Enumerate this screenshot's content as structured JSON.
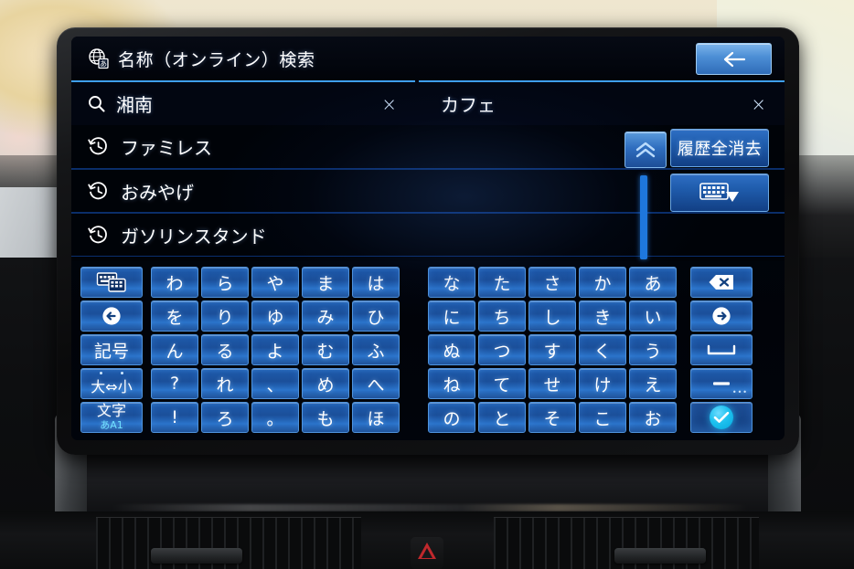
{
  "device": {
    "type": "car-navigation-head-unit",
    "hazard_button": "hazard-triangle"
  },
  "titlebar": {
    "icon": "globe-language-icon",
    "title": "名称（オンライン）検索",
    "back_button": "back-arrow-icon"
  },
  "search": {
    "fields": [
      {
        "icon": "search-icon",
        "value": "湘南",
        "clear": "×",
        "active": false
      },
      {
        "icon": "",
        "value": "カフェ",
        "clear": "×",
        "active": true
      }
    ]
  },
  "history": {
    "icon": "history-clock-icon",
    "items": [
      {
        "label": "ファミレス"
      },
      {
        "label": "おみやげ"
      },
      {
        "label": "ガソリンスタンド"
      }
    ],
    "scroll_up": "chevron-up-icon",
    "clear_all_label": "履歴全消去",
    "hide_keyboard_icon": "keyboard-down-icon"
  },
  "keyboard": {
    "left_column": [
      {
        "name": "keypad-layout-key",
        "icon": "keypad-switch-icon",
        "label": ""
      },
      {
        "name": "cursor-left-key",
        "icon": "arrow-left-circle-icon",
        "label": ""
      },
      {
        "name": "symbol-key",
        "icon": "",
        "label": "記号"
      },
      {
        "name": "case-toggle-key",
        "icon": "dakuten-marks",
        "label": "大⇔小"
      },
      {
        "name": "charset-key",
        "icon": "",
        "label": "文字",
        "sub": "あA1"
      }
    ],
    "grid_left": [
      [
        "わ",
        "ら",
        "や",
        "ま",
        "は"
      ],
      [
        "を",
        "り",
        "ゆ",
        "み",
        "ひ"
      ],
      [
        "ん",
        "る",
        "よ",
        "む",
        "ふ"
      ],
      [
        "?",
        "れ",
        "、",
        "め",
        "へ"
      ],
      [
        "!",
        "ろ",
        "。",
        "も",
        "ほ"
      ]
    ],
    "grid_right": [
      [
        "な",
        "た",
        "さ",
        "か",
        "あ"
      ],
      [
        "に",
        "ち",
        "し",
        "き",
        "い"
      ],
      [
        "ぬ",
        "つ",
        "す",
        "く",
        "う"
      ],
      [
        "ね",
        "て",
        "せ",
        "け",
        "え"
      ],
      [
        "の",
        "と",
        "そ",
        "こ",
        "お"
      ]
    ],
    "right_column": [
      {
        "name": "backspace-key",
        "icon": "backspace-icon",
        "label": ""
      },
      {
        "name": "cursor-right-key",
        "icon": "arrow-right-circle-icon",
        "label": ""
      },
      {
        "name": "space-key",
        "icon": "space-bar-icon",
        "label": ""
      },
      {
        "name": "dash-key",
        "icon": "dash-icon",
        "label": "",
        "dots": "•••"
      },
      {
        "name": "confirm-key",
        "icon": "check-icon",
        "label": ""
      }
    ]
  },
  "colors": {
    "accent_blue": "#2f6fc4",
    "key_blue": "#1d57a6",
    "confirm_cyan": "#1ec1ef",
    "scrollbar": "#1e7ae0",
    "text": "#ffffff",
    "hazard_red": "#c0282c"
  }
}
